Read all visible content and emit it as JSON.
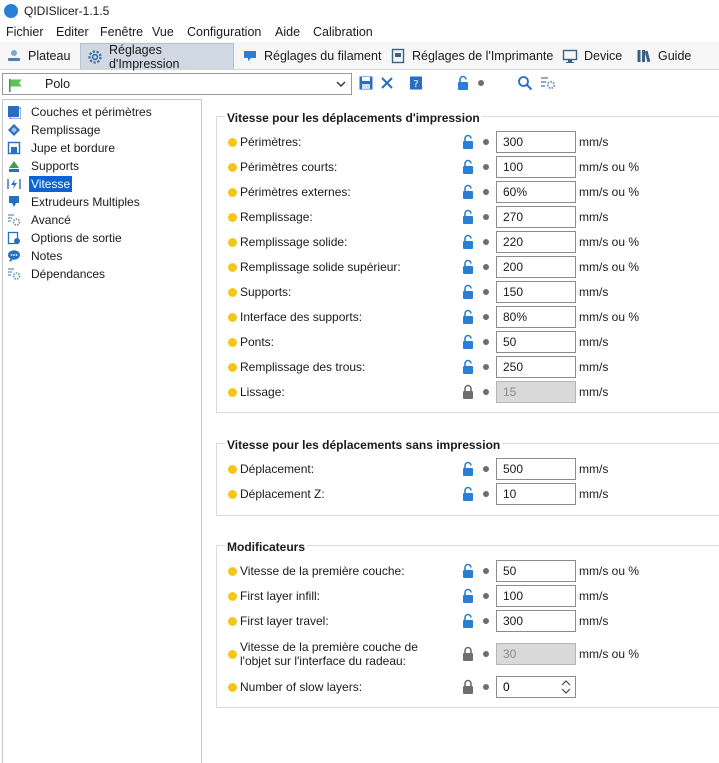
{
  "window": {
    "title": "QIDISlicer-1.1.5"
  },
  "menu": [
    "Fichier",
    "Editer",
    "Fenêtre",
    "Vue",
    "Configuration",
    "Aide",
    "Calibration"
  ],
  "tabs": [
    "Plateau",
    "Réglages d'Impression",
    "Réglages du filament",
    "Réglages de l'Imprimante",
    "Device",
    "Guide"
  ],
  "preset": {
    "name": "Polo"
  },
  "sidebar": {
    "items": [
      "Couches et périmètres",
      "Remplissage",
      "Jupe et bordure",
      "Supports",
      "Vitesse",
      "Extrudeurs Multiples",
      "Avancé",
      "Options de sortie",
      "Notes",
      "Dépendances"
    ],
    "selected": "Vitesse"
  },
  "sections": {
    "print_moves": {
      "title": "Vitesse pour les déplacements d'impression",
      "rows": [
        {
          "label": "Périmètres:",
          "value": "300",
          "unit": "mm/s"
        },
        {
          "label": "Périmètres courts:",
          "value": "100",
          "unit": "mm/s ou %"
        },
        {
          "label": "Périmètres externes:",
          "value": "60%",
          "unit": "mm/s ou %"
        },
        {
          "label": "Remplissage:",
          "value": "270",
          "unit": "mm/s"
        },
        {
          "label": "Remplissage solide:",
          "value": "220",
          "unit": "mm/s ou %"
        },
        {
          "label": "Remplissage solide supérieur:",
          "value": "200",
          "unit": "mm/s ou %"
        },
        {
          "label": "Supports:",
          "value": "150",
          "unit": "mm/s"
        },
        {
          "label": "Interface des supports:",
          "value": "80%",
          "unit": "mm/s ou %"
        },
        {
          "label": "Ponts:",
          "value": "50",
          "unit": "mm/s"
        },
        {
          "label": "Remplissage des trous:",
          "value": "250",
          "unit": "mm/s"
        },
        {
          "label": "Lissage:",
          "value": "15",
          "unit": "mm/s"
        }
      ]
    },
    "non_print_moves": {
      "title": "Vitesse pour les déplacements sans impression",
      "rows": [
        {
          "label": "Déplacement:",
          "value": "500",
          "unit": "mm/s"
        },
        {
          "label": "Déplacement Z:",
          "value": "10",
          "unit": "mm/s"
        }
      ]
    },
    "modifiers": {
      "title": "Modificateurs",
      "rows": [
        {
          "label": "Vitesse de la première couche:",
          "value": "50",
          "unit": "mm/s ou %"
        },
        {
          "label": "First layer infill:",
          "value": "100",
          "unit": "mm/s"
        },
        {
          "label": "First layer travel:",
          "value": "300",
          "unit": "mm/s"
        },
        {
          "label_line1": "Vitesse de la première couche de",
          "label_line2": "l'objet sur l'interface du radeau:",
          "value": "30",
          "unit": "mm/s ou %"
        },
        {
          "label": "Number of slow layers:",
          "value": "0"
        }
      ]
    }
  },
  "colors": {
    "accent": "#0a64d6",
    "lock_open": "#2a7fd4",
    "lock_closed": "#6e6e6e",
    "bullet": "#f5c518"
  }
}
